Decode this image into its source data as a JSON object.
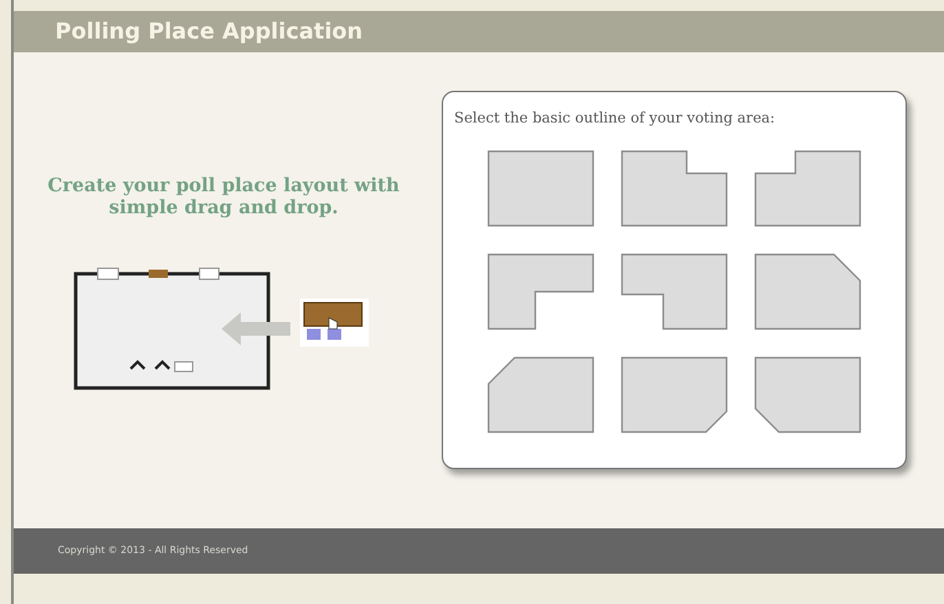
{
  "header": {
    "title": "Polling Place Application"
  },
  "intro": {
    "heading": "Create your poll place layout with simple drag and drop."
  },
  "outline_panel": {
    "prompt": "Select the basic outline of your voting area:",
    "outlines": [
      {
        "kind": "rectangle"
      },
      {
        "kind": "notch-top-right"
      },
      {
        "kind": "notch-top-left"
      },
      {
        "kind": "notch-bottom-right"
      },
      {
        "kind": "notch-bottom-left"
      },
      {
        "kind": "chamfer-top-right"
      },
      {
        "kind": "chamfer-top-left"
      },
      {
        "kind": "chamfer-bottom-right"
      },
      {
        "kind": "chamfer-bottom-left"
      }
    ]
  },
  "footer": {
    "copyright": "Copyright © 2013 - All Rights Reserved"
  }
}
